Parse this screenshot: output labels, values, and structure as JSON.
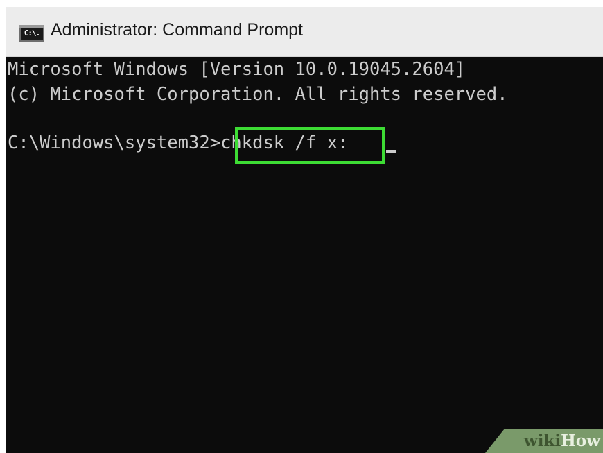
{
  "window": {
    "title": "Administrator: Command Prompt",
    "icon": "cmd-icon",
    "icon_glyph": "C:\\."
  },
  "console": {
    "lines": [
      "Microsoft Windows [Version 10.0.19045.2604]",
      "(c) Microsoft Corporation. All rights reserved.",
      "",
      "C:\\Windows\\system32>chkdsk /f x:"
    ],
    "highlighted_command": "chkdsk /f x:",
    "highlight_color": "#3ddc34",
    "text_color": "#cccccc",
    "background_color": "#0c0c0c"
  },
  "watermark": {
    "wiki": "wiki",
    "how": "How"
  }
}
